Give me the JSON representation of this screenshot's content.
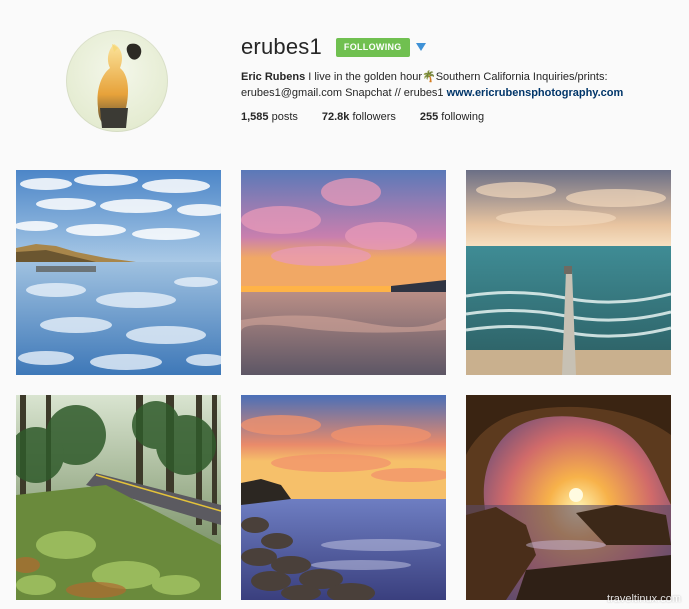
{
  "profile": {
    "username": "erubes1",
    "follow_button": "FOLLOWING",
    "bio": {
      "full_name": "Eric Rubens",
      "text_part1": " I live in the golden hour",
      "emoji": "🌴",
      "text_part2": "Southern California Inquiries/prints: erubes1@gmail.com Snapchat // erubes1 ",
      "link": "www.ericrubensphotography.com"
    },
    "stats": {
      "posts_count": "1,585",
      "posts_label": " posts",
      "followers_count": "72.8k",
      "followers_label": " followers",
      "following_count": "255",
      "following_label": " following"
    }
  },
  "posts": [
    {
      "subject": "coastal tide pool reflecting cloudy sky"
    },
    {
      "subject": "pink sunset over wet sandy beach"
    },
    {
      "subject": "aerial view of pier into the ocean"
    },
    {
      "subject": "forest road with ferns"
    },
    {
      "subject": "rocky shoreline at sunset"
    },
    {
      "subject": "sea cave arch framing sunset"
    }
  ],
  "watermark": "traveltinux.com",
  "colors": {
    "follow_button": "#70c050",
    "link": "#003569",
    "dropdown": "#3f91d6"
  }
}
